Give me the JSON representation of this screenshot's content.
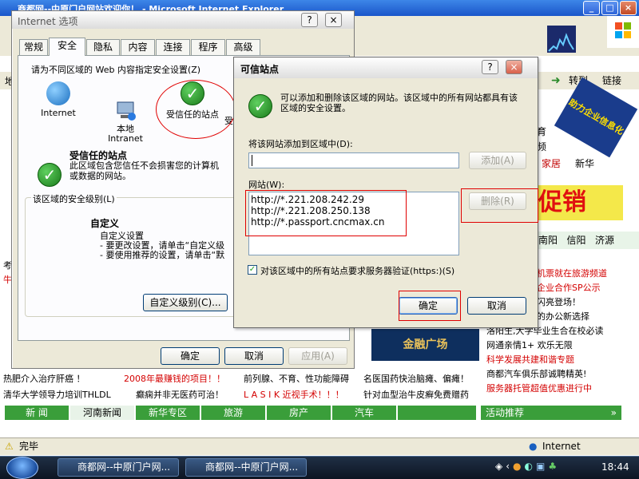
{
  "browser": {
    "title": "商都网--中原门户网站欢迎你！ - Microsoft Internet Explorer",
    "go_label": "转到",
    "links_label": "链接",
    "status": "完毕",
    "zone": "Internet",
    "ad_text": "促销",
    "promo_badge": "助力企业信息化",
    "right_links": [
      "育",
      "频",
      "家居",
      "新华",
      "南阳",
      "信阳",
      "济源"
    ],
    "right_news": [
      "机票就在旅游频道",
      "企业合作SP公示",
      "闪亮登场！",
      "的办公新选择",
      "洛阳生,大学毕业生合在校必读",
      "网通亲情1+   欢乐无限",
      "科学发展共建和谐专题",
      "商都汽车俱乐部诚聘精英!",
      "服务器托管超值优惠进行中"
    ],
    "bottom_news": [
      {
        "text": "热肥介入治疗肝癌 ！",
        "red": false
      },
      {
        "text": "2008年最赚钱的项目！！",
        "red": true
      },
      {
        "text": "前列腺、不育、性功能障碍",
        "red": false
      },
      {
        "text": "名医国药快治脑瘫、偏瘫！",
        "red": false
      },
      {
        "text": "清华大学领导力培训THLDL",
        "red": false
      },
      {
        "text": "癫痫并非无医药可治！",
        "red": false
      },
      {
        "text": "L A S I K 近视手术！！！",
        "red": true
      },
      {
        "text": "针对血型治牛皮癣免费赠药",
        "red": false
      }
    ],
    "left_news": [
      "考",
      "牛"
    ],
    "golden_plaza": "金融广场",
    "nav_tabs": [
      "新 闻",
      "河南新闻",
      "新华专区",
      "旅游",
      "房产",
      "汽车"
    ],
    "activity_label": "活动推荐"
  },
  "inet_options": {
    "title": "Internet 选项",
    "help": "?",
    "close": "×",
    "tabs": [
      "常规",
      "安全",
      "隐私",
      "内容",
      "连接",
      "程序",
      "高级"
    ],
    "instruction": "请为不同区域的 Web 内容指定安全设置(Z)",
    "zones": [
      {
        "label": "Internet",
        "icon": "globe-icon"
      },
      {
        "label": "本地\nIntranet",
        "icon": "intranet-icon"
      },
      {
        "label": "受信任的站点",
        "icon": "trusted-check-icon"
      },
      {
        "label": "受限",
        "icon": "restricted-icon"
      }
    ],
    "zone_title": "受信任的站点",
    "zone_desc": "此区域包含您信任不会损害您的计算机或数据的网站。",
    "level_label": "该区域的安全级别(L)",
    "custom_title": "自定义",
    "custom_lines": [
      "自定义设置",
      "- 要更改设置，请单击“自定义级",
      "- 要使用推荐的设置，请单击“默"
    ],
    "custom_level_button": "自定义级别(C)...",
    "ok": "确定",
    "cancel": "取消",
    "apply": "应用(A)"
  },
  "trusted_sites": {
    "title": "可信站点",
    "help": "?",
    "close": "×",
    "description": "可以添加和删除该区域的网站。该区域中的所有网站都具有该区域的安全设置。",
    "add_label": "将该网站添加到区域中(D):",
    "add_value": "",
    "add_button": "添加(A)",
    "sites_label": "网站(W):",
    "sites": [
      "http://*.221.208.242.29",
      "http://*.221.208.250.138",
      "http://*.passport.cncmax.cn"
    ],
    "remove_button": "删除(R)",
    "verify_label": "对该区域中的所有站点要求服务器验证(https:)(S)",
    "verify_checked": true,
    "ok": "确定",
    "cancel": "取消"
  },
  "taskbar": {
    "buttons": [
      "商都网--中原门户网...",
      "商都网--中原门户网..."
    ],
    "clock": "18:44"
  },
  "colors": {
    "accent_red": "#e00000",
    "nav_green": "#3a9e3a",
    "dialog_bg": "#ece9d8"
  }
}
